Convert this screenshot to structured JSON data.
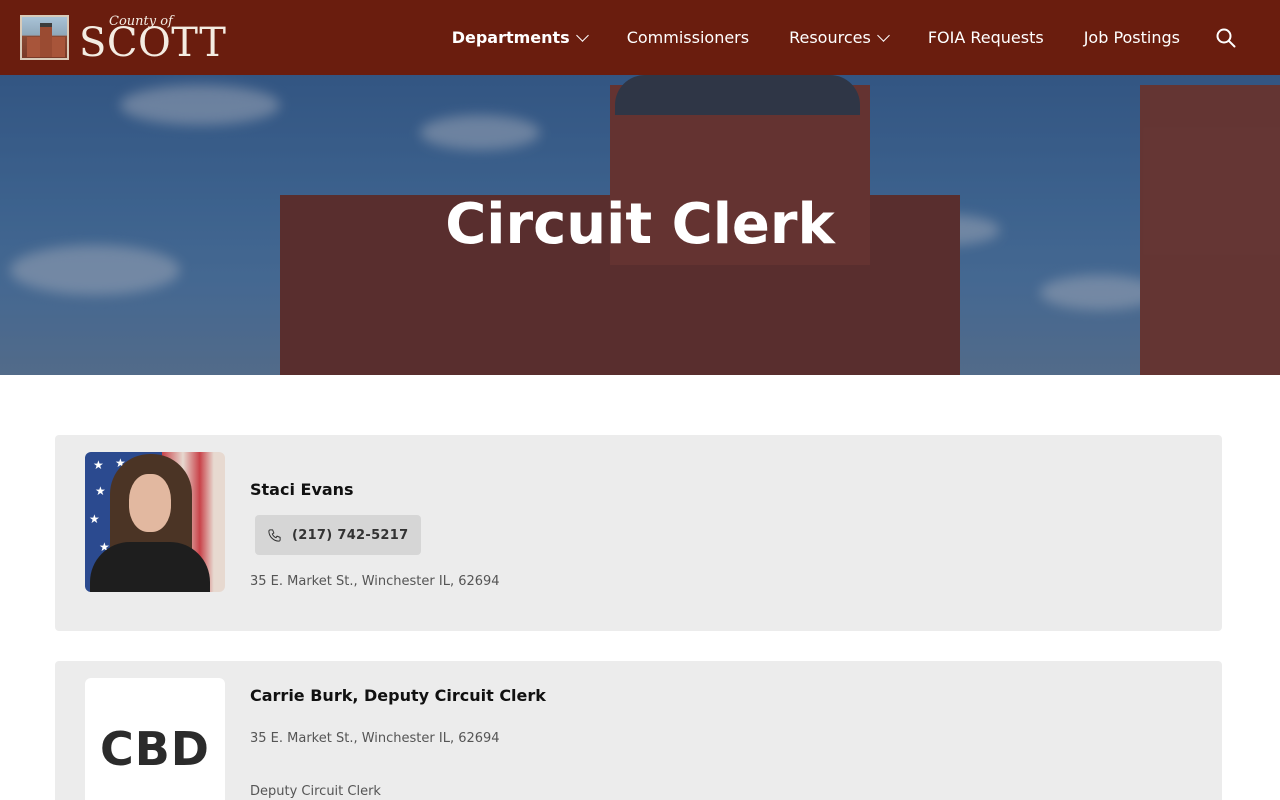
{
  "header": {
    "logo_sub": "County of",
    "logo_main": "SCOTT",
    "nav": [
      {
        "label": "Departments",
        "has_dropdown": true,
        "active": true
      },
      {
        "label": "Commissioners",
        "has_dropdown": false
      },
      {
        "label": "Resources",
        "has_dropdown": true
      },
      {
        "label": "FOIA Requests",
        "has_dropdown": false
      },
      {
        "label": "Job Postings",
        "has_dropdown": false
      }
    ],
    "search_icon": "search-icon",
    "color": "#6a1d0e"
  },
  "hero": {
    "title": "Circuit Clerk"
  },
  "contacts": [
    {
      "name": "Staci Evans",
      "phone": "(217) 742-5217",
      "address": "35 E. Market St., Winchester IL, 62694"
    },
    {
      "initials": "CBD",
      "name": "Carrie Burk, Deputy Circuit Clerk",
      "address": "35 E. Market St., Winchester IL, 62694",
      "role": "Deputy Circuit Clerk"
    }
  ]
}
